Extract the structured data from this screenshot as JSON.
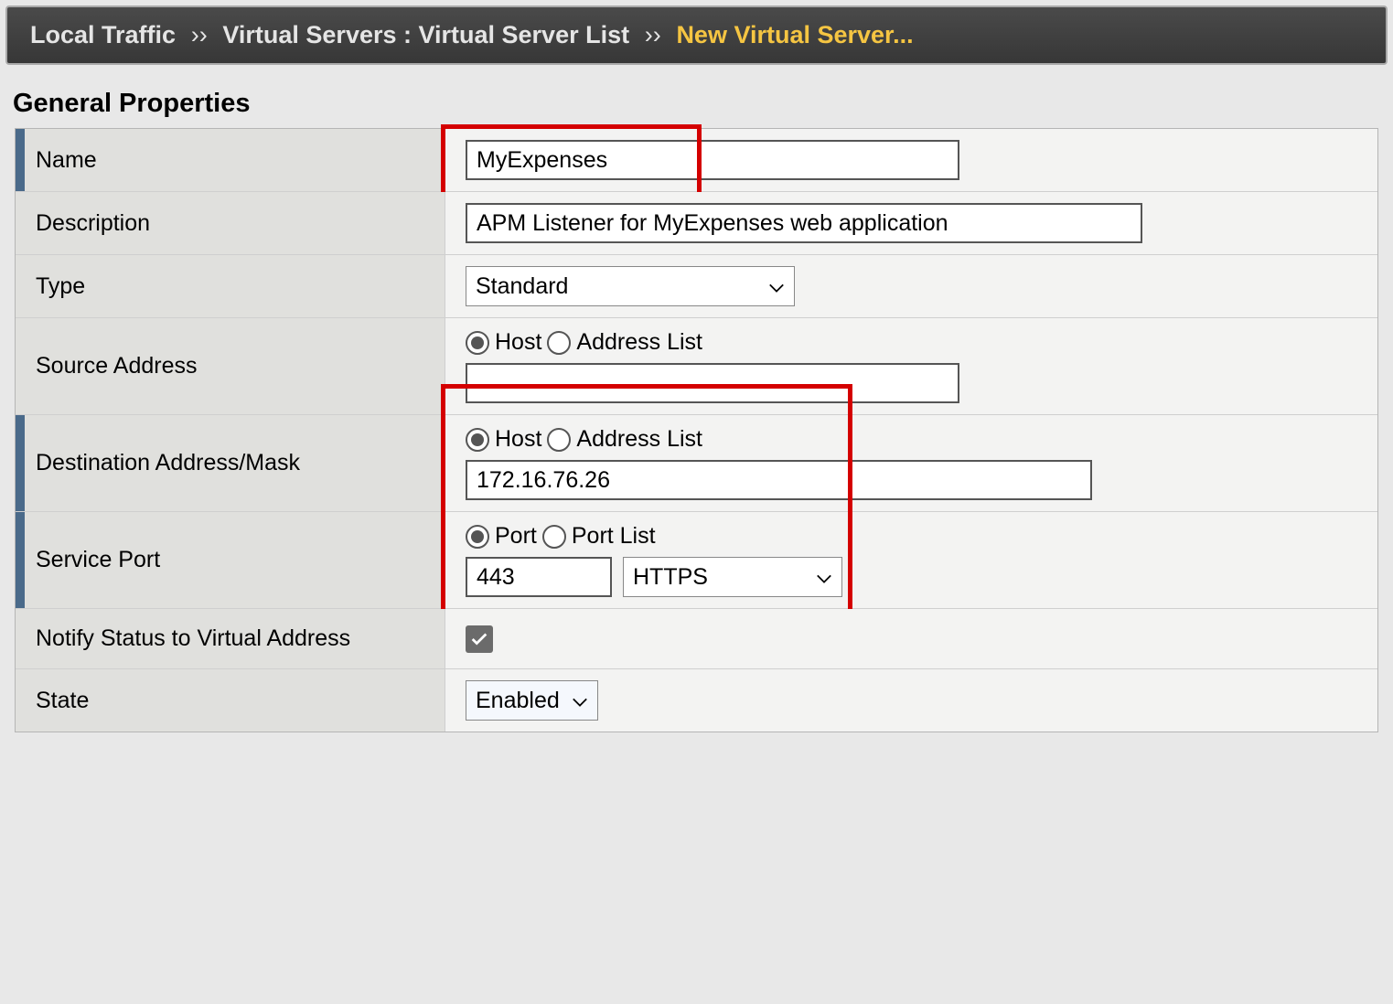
{
  "breadcrumb": {
    "seg1": "Local Traffic",
    "sep": "››",
    "seg2": "Virtual Servers : Virtual Server List",
    "seg3": "New Virtual Server..."
  },
  "section_title": "General Properties",
  "fields": {
    "name": {
      "label": "Name",
      "value": "MyExpenses"
    },
    "description": {
      "label": "Description",
      "value": "APM Listener for MyExpenses web application"
    },
    "type": {
      "label": "Type",
      "selected": "Standard"
    },
    "source_address": {
      "label": "Source Address",
      "radio_host": "Host",
      "radio_list": "Address List",
      "value": ""
    },
    "dest_address": {
      "label": "Destination Address/Mask",
      "radio_host": "Host",
      "radio_list": "Address List",
      "value": "172.16.76.26"
    },
    "service_port": {
      "label": "Service Port",
      "radio_port": "Port",
      "radio_list": "Port List",
      "value": "443",
      "protocol": "HTTPS"
    },
    "notify": {
      "label": "Notify Status to Virtual Address"
    },
    "state": {
      "label": "State",
      "selected": "Enabled"
    }
  }
}
